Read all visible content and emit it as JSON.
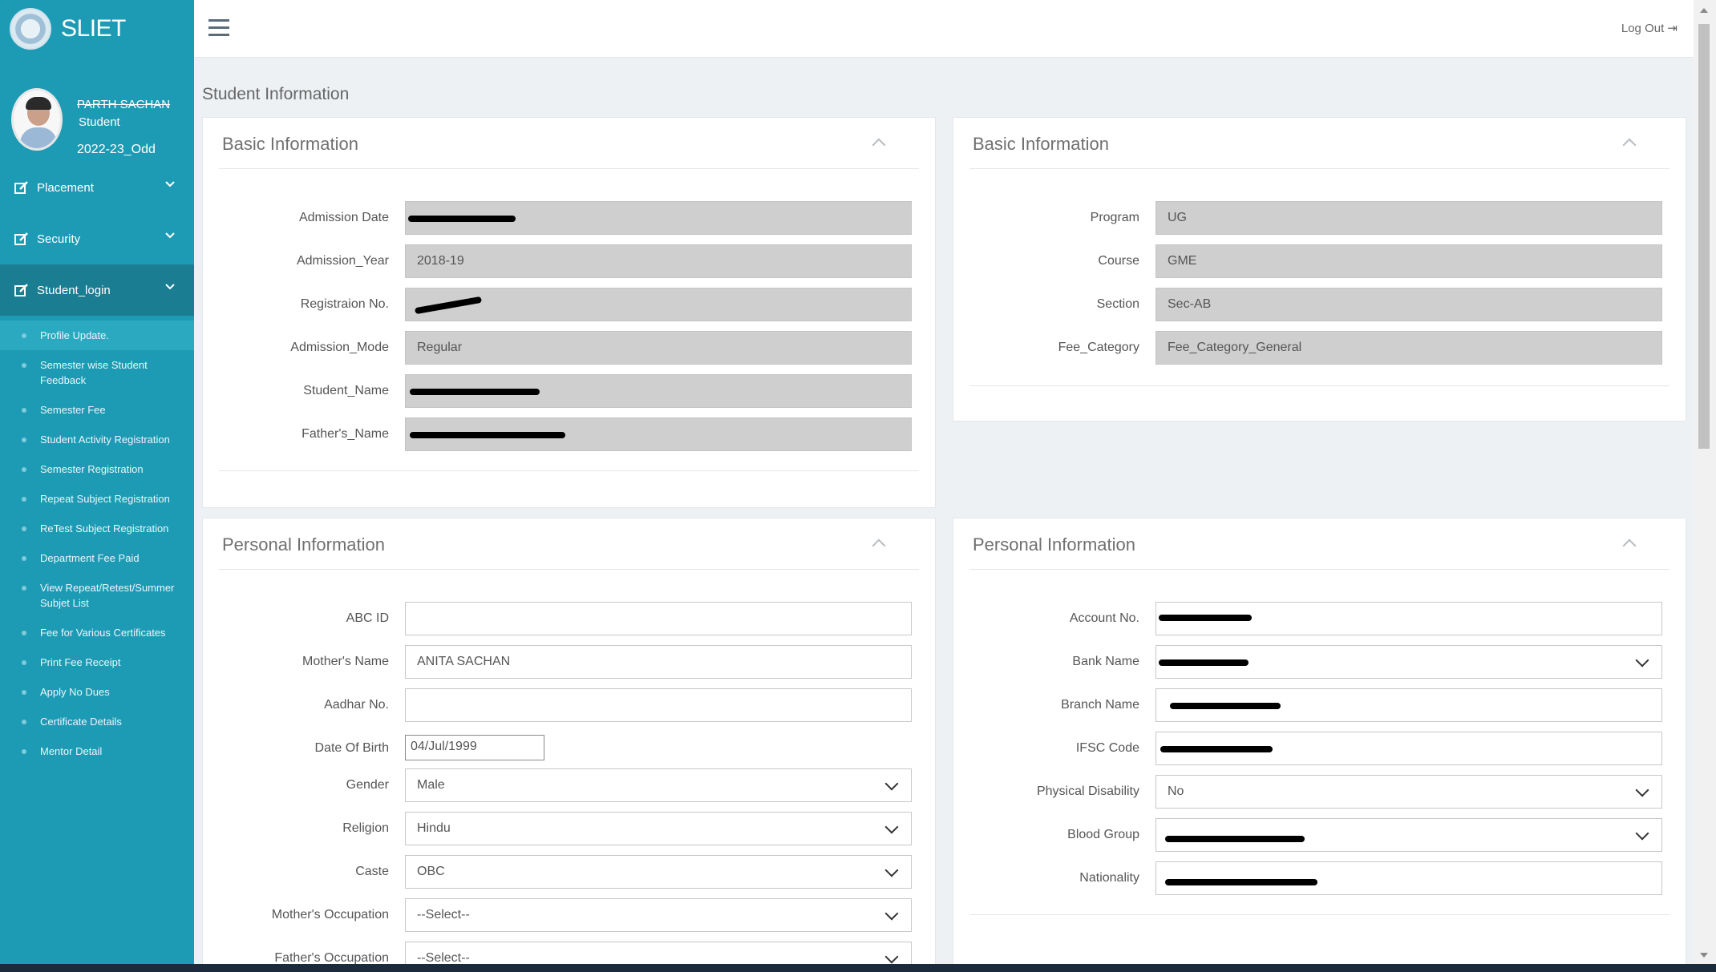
{
  "brand": {
    "name": "SLIET"
  },
  "profile": {
    "name": "PARTH SACHAN",
    "role": "Student",
    "term": "2022-23_Odd"
  },
  "sidebar": {
    "menu": [
      {
        "label": "Placement"
      },
      {
        "label": "Security"
      },
      {
        "label": "Student_login"
      }
    ],
    "submenu": [
      {
        "label": "Profile Update."
      },
      {
        "label": "Semester wise Student Feedback"
      },
      {
        "label": "Semester Fee"
      },
      {
        "label": "Student Activity Registration"
      },
      {
        "label": "Semester Registration"
      },
      {
        "label": "Repeat Subject Registration"
      },
      {
        "label": "ReTest Subject Registration"
      },
      {
        "label": "Department Fee Paid"
      },
      {
        "label": "View Repeat/Retest/Summer Subjet List"
      },
      {
        "label": "Fee for Various Certificates"
      },
      {
        "label": "Print Fee Receipt"
      },
      {
        "label": "Apply No Dues"
      },
      {
        "label": "Certificate Details"
      },
      {
        "label": "Mentor Detail"
      }
    ]
  },
  "topbar": {
    "logout": "Log Out"
  },
  "page": {
    "title": "Student Information"
  },
  "basic_left": {
    "title": "Basic Information",
    "rows": [
      {
        "label": "Admission Date",
        "value": ""
      },
      {
        "label": "Admission_Year",
        "value": "2018-19"
      },
      {
        "label": "Registraion No.",
        "value": ""
      },
      {
        "label": "Admission_Mode",
        "value": "Regular"
      },
      {
        "label": "Student_Name",
        "value": ""
      },
      {
        "label": "Father's_Name",
        "value": ""
      }
    ]
  },
  "basic_right": {
    "title": "Basic Information",
    "rows": [
      {
        "label": "Program",
        "value": "UG"
      },
      {
        "label": "Course",
        "value": "GME"
      },
      {
        "label": "Section",
        "value": "Sec-AB"
      },
      {
        "label": "Fee_Category",
        "value": "Fee_Category_General"
      }
    ]
  },
  "personal_left": {
    "title": "Personal Information",
    "rows": [
      {
        "label": "ABC ID",
        "value": ""
      },
      {
        "label": "Mother's Name",
        "value": "ANITA SACHAN"
      },
      {
        "label": "Aadhar No.",
        "value": ""
      },
      {
        "label": "Date Of Birth",
        "value": "04/Jul/1999"
      },
      {
        "label": "Gender",
        "value": "Male"
      },
      {
        "label": "Religion",
        "value": "Hindu"
      },
      {
        "label": "Caste",
        "value": "OBC"
      },
      {
        "label": "Mother's Occupation",
        "value": "--Select--"
      },
      {
        "label": "Father's Occupation",
        "value": "--Select--"
      }
    ]
  },
  "personal_right": {
    "title": "Personal Information",
    "rows": [
      {
        "label": "Account No.",
        "value": ""
      },
      {
        "label": "Bank Name",
        "value": ""
      },
      {
        "label": "Branch Name",
        "value": ""
      },
      {
        "label": "IFSC Code",
        "value": ""
      },
      {
        "label": "Physical Disability",
        "value": "No"
      },
      {
        "label": "Blood Group",
        "value": ""
      },
      {
        "label": "Nationality",
        "value": ""
      }
    ]
  }
}
